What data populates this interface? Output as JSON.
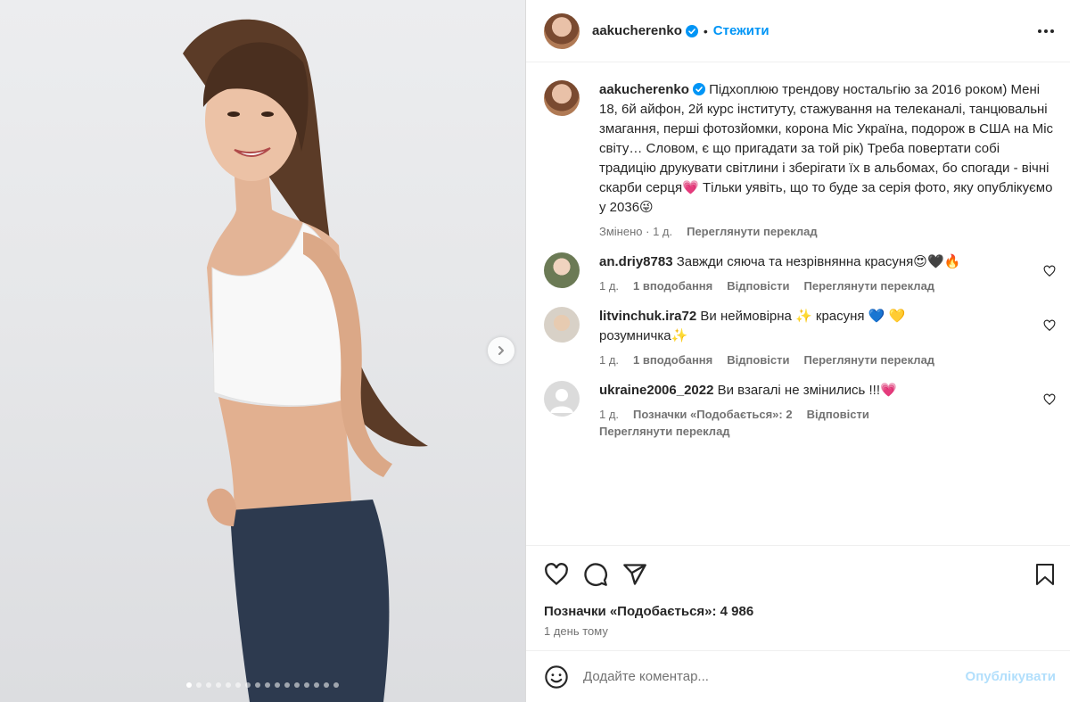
{
  "post": {
    "author": "aakucherenko",
    "follow_label": "Стежити",
    "separator": "•",
    "caption": "Підхоплюю трендову ностальгію за 2016 роком) Мені 18, 6й айфон, 2й курс інституту, стажування на телеканалі, танцювальні змагання, перші фотозйомки, корона Міс Україна, подорож в США на Міс світу… Словом, є що пригадати за той рік) Треба повертати собі традицію друкувати світлини і зберігати їх в альбомах, бо спогади - вічні скарби серця💗 Тільки уявіть, що то буде за серія фото, яку опублікуємо у 2036😜",
    "caption_status": "Змінено",
    "caption_time": "1 д.",
    "translate_label": "Переглянути переклад"
  },
  "comments": [
    {
      "user": "an.driy8783",
      "text": "Завжди сяюча та незрівнянна красуня😍🖤🔥",
      "time": "1 д.",
      "likes": "1 вподобання",
      "reply": "Відповісти",
      "translate": "Переглянути переклад"
    },
    {
      "user": "litvinchuk.ira72",
      "text": "Ви неймовірна ✨ красуня 💙 💛 розумничка✨",
      "time": "1 д.",
      "likes": "1 вподобання",
      "reply": "Відповісти",
      "translate": "Переглянути переклад"
    },
    {
      "user": "ukraine2006_2022",
      "text": "Ви взагалі не змінились !!!💗",
      "time": "1 д.",
      "likes": "Позначки «Подобається»: 2",
      "reply": "Відповісти",
      "translate": "Переглянути переклад"
    }
  ],
  "stats": {
    "likes": "Позначки «Подобається»: 4 986",
    "date": "1 день тому"
  },
  "composer": {
    "placeholder": "Додайте коментар...",
    "post_label": "Опублікувати"
  },
  "carousel": {
    "total": 16,
    "active_index": 0
  },
  "colors": {
    "link": "#0095f6",
    "post_disabled": "#b2dffc",
    "muted": "#737373",
    "text": "#262626"
  }
}
